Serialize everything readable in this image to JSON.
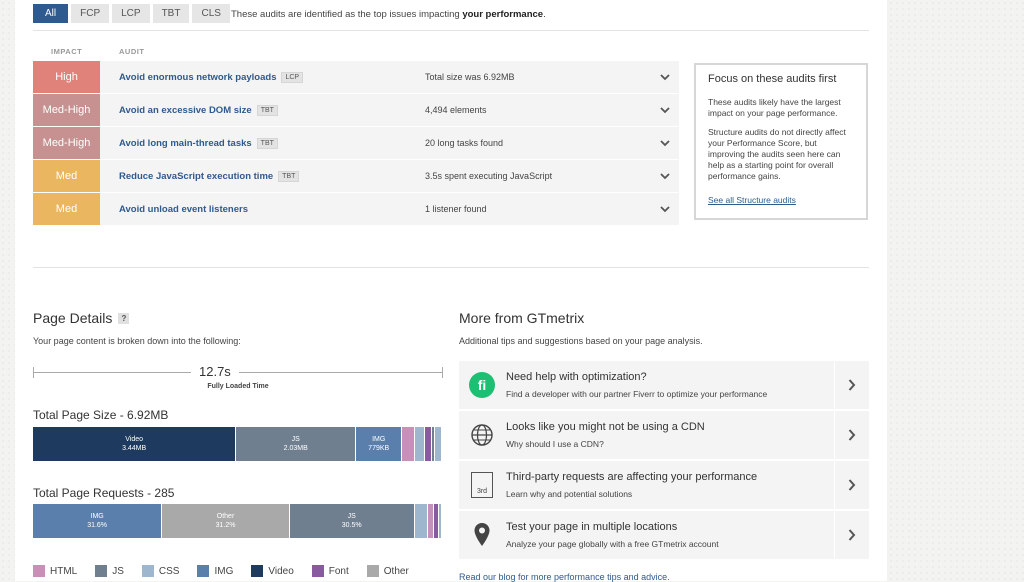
{
  "filters": {
    "tabs": [
      {
        "label": "All",
        "active": true
      },
      {
        "label": "FCP",
        "active": false
      },
      {
        "label": "LCP",
        "active": false
      },
      {
        "label": "TBT",
        "active": false
      },
      {
        "label": "CLS",
        "active": false
      }
    ],
    "note_prefix": "These audits are identified as the top issues impacting ",
    "note_bold": "your performance",
    "note_suffix": "."
  },
  "table_headers": {
    "impact": "IMPACT",
    "audit": "AUDIT"
  },
  "audits": [
    {
      "impact": "High",
      "color": "#e0827a",
      "title": "Avoid enormous network payloads",
      "metric": "LCP",
      "value": "Total size was 6.92MB"
    },
    {
      "impact": "Med-High",
      "color": "#c69190",
      "title": "Avoid an excessive DOM size",
      "metric": "TBT",
      "value": "4,494 elements"
    },
    {
      "impact": "Med-High",
      "color": "#c69190",
      "title": "Avoid long main-thread tasks",
      "metric": "TBT",
      "value": "20 long tasks found"
    },
    {
      "impact": "Med",
      "color": "#eab65f",
      "title": "Reduce JavaScript execution time",
      "metric": "TBT",
      "value": "3.5s spent executing JavaScript"
    },
    {
      "impact": "Med",
      "color": "#eab65f",
      "title": "Avoid unload event listeners",
      "metric": "",
      "value": "1 listener found"
    }
  ],
  "focus": {
    "title": "Focus on these audits first",
    "p1": "These audits likely have the largest impact on your page performance.",
    "p2": "Structure audits do not directly affect your Performance Score, but improving the audits seen here can help as a starting point for overall performance gains.",
    "link": "See all Structure audits"
  },
  "page_details": {
    "title": "Page Details",
    "help": "?",
    "subtitle": "Your page content is broken down into the following:",
    "fully_loaded_value": "12.7s",
    "fully_loaded_label": "Fully Loaded Time",
    "size_title": "Total Page Size - 6.92MB",
    "requests_title": "Total Page Requests - 285"
  },
  "colors": {
    "HTML": "#c890b8",
    "JS": "#6f7f90",
    "CSS": "#9fb6cf",
    "IMG": "#5b7fad",
    "Video": "#1e3a5f",
    "Font": "#8a5aa0",
    "Other": "#a9a9a9"
  },
  "size_segments": [
    {
      "type": "Video",
      "name": "Video",
      "value": "3.44MB",
      "share": 49.7
    },
    {
      "type": "JS",
      "name": "JS",
      "value": "2.03MB",
      "share": 29.3
    },
    {
      "type": "IMG",
      "name": "IMG",
      "value": "779KB",
      "share": 11.3
    },
    {
      "type": "HTML",
      "name": "",
      "value": "",
      "share": 3.0
    },
    {
      "type": "CSS",
      "name": "",
      "value": "",
      "share": 2.5
    },
    {
      "type": "Font",
      "name": "",
      "value": "",
      "share": 1.8
    },
    {
      "type": "JS",
      "name": "",
      "value": "",
      "share": 0.8
    },
    {
      "type": "CSS",
      "name": "",
      "value": "",
      "share": 1.6
    }
  ],
  "request_segments": [
    {
      "type": "IMG",
      "name": "IMG",
      "value": "31.6%",
      "share": 31.6
    },
    {
      "type": "Other",
      "name": "Other",
      "value": "31.2%",
      "share": 31.2
    },
    {
      "type": "JS",
      "name": "JS",
      "value": "30.5%",
      "share": 30.5
    },
    {
      "type": "CSS",
      "name": "",
      "value": "",
      "share": 3.2
    },
    {
      "type": "HTML",
      "name": "",
      "value": "",
      "share": 1.5
    },
    {
      "type": "Font",
      "name": "",
      "value": "",
      "share": 1.2
    },
    {
      "type": "CSS",
      "name": "",
      "value": "",
      "share": 0.8
    }
  ],
  "legend": [
    "HTML",
    "JS",
    "CSS",
    "IMG",
    "Video",
    "Font",
    "Other"
  ],
  "more": {
    "title": "More from GTmetrix",
    "subtitle": "Additional tips and suggestions based on your page analysis.",
    "cards": [
      {
        "icon": "fiverr-icon",
        "title": "Need help with optimization?",
        "sub": "Find a developer with our partner Fiverr to optimize your performance"
      },
      {
        "icon": "globe-icon",
        "title": "Looks like you might not be using a CDN",
        "sub": "Why should I use a CDN?"
      },
      {
        "icon": "third-party-icon",
        "title": "Third-party requests are affecting your performance",
        "sub": "Learn why and potential solutions",
        "badge": "3rd"
      },
      {
        "icon": "location-pin-icon",
        "title": "Test your page in multiple locations",
        "sub": "Analyze your page globally with a free GTmetrix account"
      }
    ],
    "blog_link": "Read our blog for more performance tips and advice."
  }
}
